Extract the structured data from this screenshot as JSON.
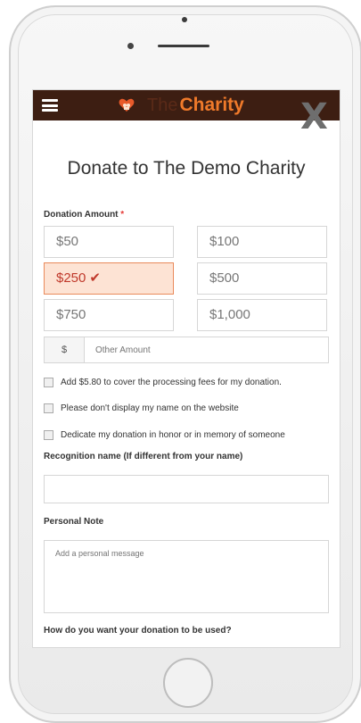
{
  "header": {
    "logo_the": "The",
    "logo_charity": "Charity",
    "close_label": "X"
  },
  "form": {
    "title": "Donate to The Demo Charity",
    "donation_amount_label": "Donation Amount",
    "required_mark": "*",
    "amounts": [
      "$50",
      "$100",
      "$250",
      "$500",
      "$750",
      "$1,000"
    ],
    "selected_amount": "$250",
    "check_mark": "✔",
    "currency_symbol": "$",
    "other_amount_placeholder": "Other Amount",
    "options": [
      "Add $5.80 to cover the processing fees for my donation.",
      "Please don't display my name on the website",
      "Dedicate my donation in honor or in memory of someone"
    ],
    "recognition_label": "Recognition name (If different from your name)",
    "recognition_value": "",
    "personal_note_label": "Personal Note",
    "personal_note_placeholder": "Add a personal message",
    "usage_label": "How do you want your donation to be used?"
  },
  "colors": {
    "header_bg": "#3d1e12",
    "accent": "#f07a2a",
    "selected_bg": "#fde3d4",
    "required": "#e53935"
  }
}
